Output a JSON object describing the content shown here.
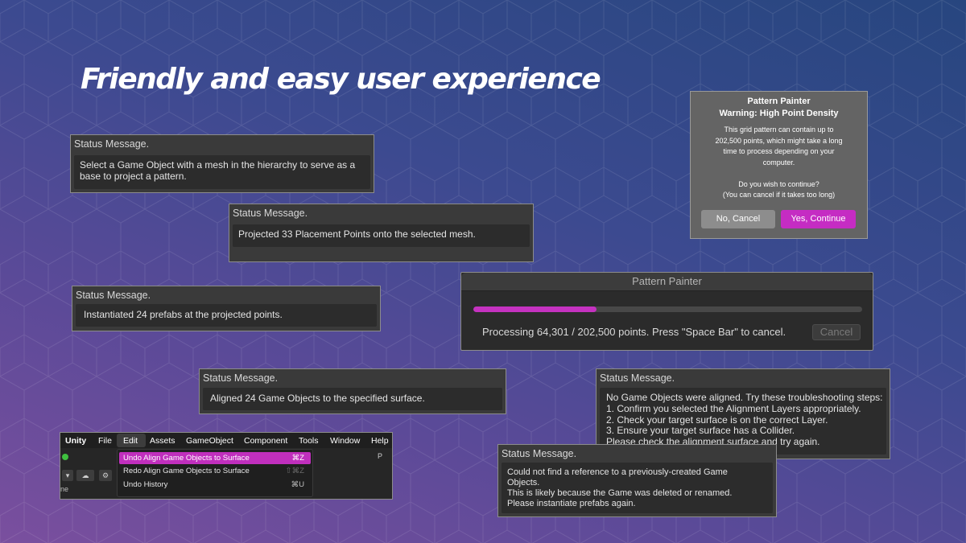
{
  "headline": "Friendly and easy user experience",
  "colors": {
    "accent_magenta": "#c52cc3",
    "panel_bg": "#3a3a3a",
    "panel_body_bg": "#2c2c2c",
    "dialog_bg": "#646464"
  },
  "status_messages": [
    {
      "title": "Status Message.",
      "lines": [
        "Select a Game Object with a mesh in the hierarchy to serve as a",
        "base to project a pattern."
      ]
    },
    {
      "title": "Status Message.",
      "lines": [
        "Projected 33 Placement Points onto the selected mesh."
      ]
    },
    {
      "title": "Status Message.",
      "lines": [
        "Instantiated 24 prefabs at the projected points."
      ]
    },
    {
      "title": "Status Message.",
      "lines": [
        "Aligned 24 Game Objects to the specified surface."
      ]
    },
    {
      "title": "Status Message.",
      "lines": [
        "No Game Objects were aligned. Try these troubleshooting steps:",
        "1. Confirm you selected the Alignment Layers appropriately.",
        "2. Check your target surface is on the correct Layer.",
        "3. Ensure your target surface has a Collider.",
        "Please check the alignment surface and try again."
      ]
    },
    {
      "title": "Status Message.",
      "lines": [
        "Could not find a reference to a previously-created Game",
        "Objects.",
        "This is likely because the Game was deleted or renamed.",
        "Please instantiate prefabs again."
      ]
    }
  ],
  "warning_dialog": {
    "title": "Pattern Painter",
    "subtitle": "Warning: High Point Density",
    "body_lines": [
      "This grid pattern can contain up to",
      "202,500 points, which might take a long",
      "time to process depending on your",
      "computer.",
      "",
      "Do you wish to continue?",
      "(You can cancel if it takes too long)"
    ],
    "cancel_label": "No, Cancel",
    "confirm_label": "Yes, Continue"
  },
  "progress_dialog": {
    "title": "Pattern Painter",
    "progress_fraction": 0.3175,
    "message": "Processing 64,301 / 202,500 points. Press \"Space Bar\" to cancel.",
    "cancel_label": "Cancel"
  },
  "unity_menu": {
    "menubar": [
      "Unity",
      "File",
      "Edit",
      "Assets",
      "GameObject",
      "Component",
      "Tools",
      "Window",
      "Help"
    ],
    "active_menu": "Edit",
    "items": [
      {
        "label": "Undo Align Game Objects to Surface",
        "shortcut": "⌘Z",
        "state": "highlighted"
      },
      {
        "label": "Redo Align Game Objects to Surface",
        "shortcut": "⇧⌘Z",
        "state": "disabled"
      },
      {
        "label": "Undo History",
        "shortcut": "⌘U",
        "state": "normal"
      }
    ],
    "toolbar_fragments": {
      "left_text": "ne",
      "right_glyph": "P"
    }
  }
}
